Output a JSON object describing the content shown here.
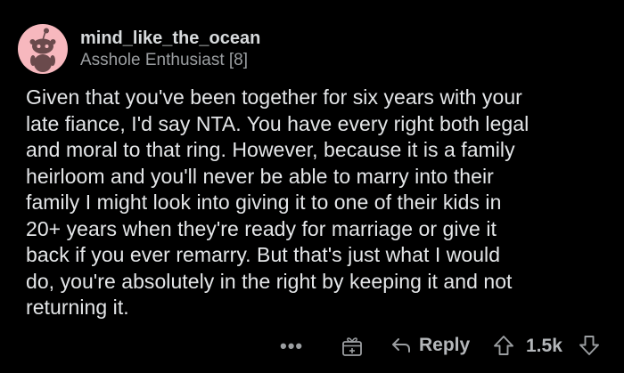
{
  "comment": {
    "username": "mind_like_the_ocean",
    "flair": "Asshole Enthusiast [8]",
    "body": "Given that you've been together for six years with your\nlate fiance, I'd say NTA. You have every right both legal\nand moral to that ring. However, because it is a family\nheirloom and you'll never be able to marry into their\nfamily I might look into giving it to one of their kids in\n20+ years when they're ready for marriage or give it\nback if you ever remarry. But that's just what I would\ndo, you're absolutely in the right by keeping it and not\nreturning it."
  },
  "actions": {
    "more_label": "•••",
    "reply_label": "Reply",
    "score": "1.5k"
  },
  "icons": {
    "avatar": "snoo-avatar-icon",
    "more": "more-options-icon",
    "award": "award-gift-icon",
    "reply": "reply-arrow-icon",
    "upvote": "upvote-arrow-icon",
    "downvote": "downvote-arrow-icon"
  },
  "colors": {
    "background": "#000000",
    "text": "#e4e6e8",
    "muted": "#9b9ea1",
    "avatar_bg": "#f7b8be"
  }
}
